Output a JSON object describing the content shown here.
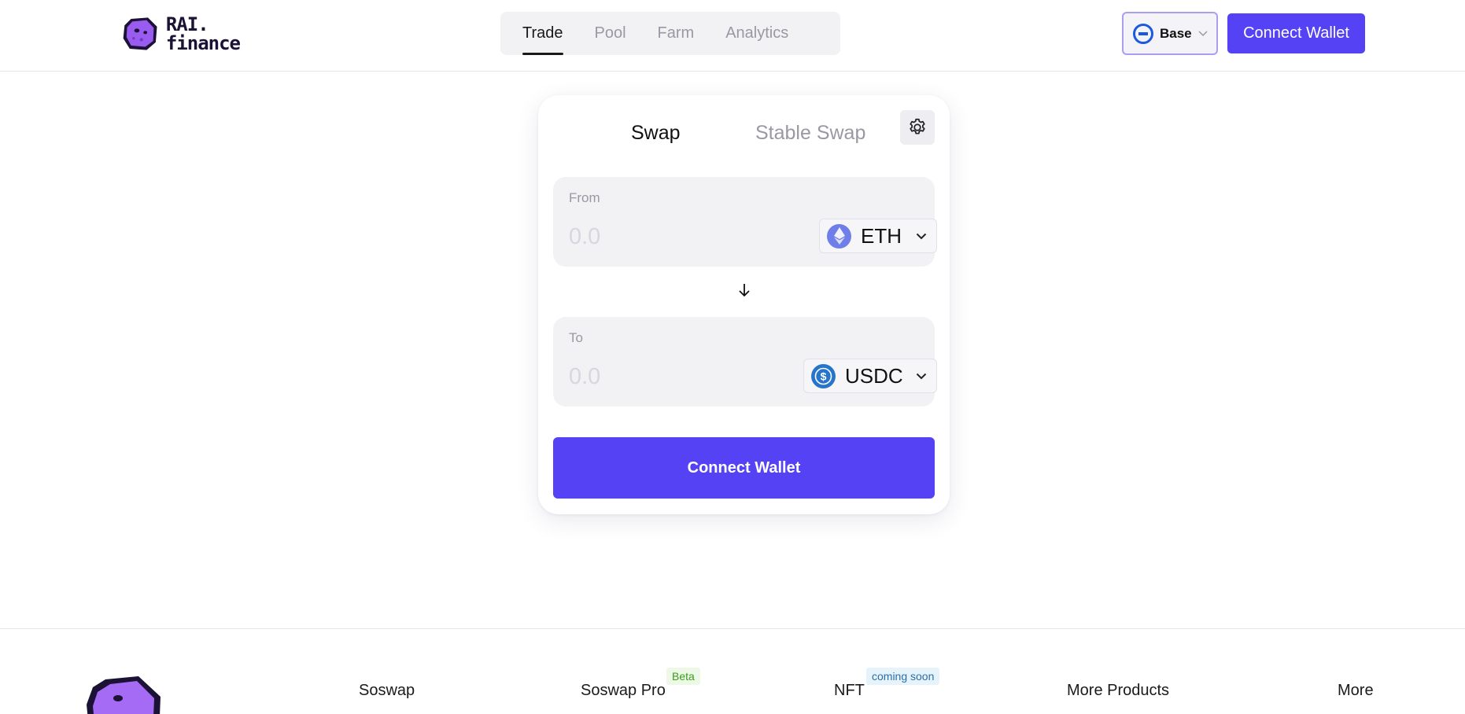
{
  "header": {
    "logo_text_line1": "RAI.",
    "logo_text_line2": "finance",
    "nav": [
      {
        "label": "Trade",
        "active": true
      },
      {
        "label": "Pool",
        "active": false
      },
      {
        "label": "Farm",
        "active": false
      },
      {
        "label": "Analytics",
        "active": false
      }
    ],
    "network": {
      "label": "Base",
      "icon": "base-network-icon"
    },
    "connect_label": "Connect Wallet"
  },
  "swap": {
    "tabs": {
      "swap": "Swap",
      "stable": "Stable Swap"
    },
    "from": {
      "label": "From",
      "placeholder": "0.0",
      "token": "ETH"
    },
    "to": {
      "label": "To",
      "placeholder": "0.0",
      "token": "USDC"
    },
    "connect_label": "Connect Wallet"
  },
  "footer": {
    "columns": {
      "soswap": "Soswap",
      "pro": "Soswap Pro",
      "nft": "NFT",
      "more_products": "More Products",
      "more": "More"
    },
    "badges": {
      "beta": "Beta",
      "soon": "coming soon"
    }
  },
  "colors": {
    "accent": "#5542f4",
    "panel": "#f2f1f4",
    "muted": "#9a98a3"
  }
}
